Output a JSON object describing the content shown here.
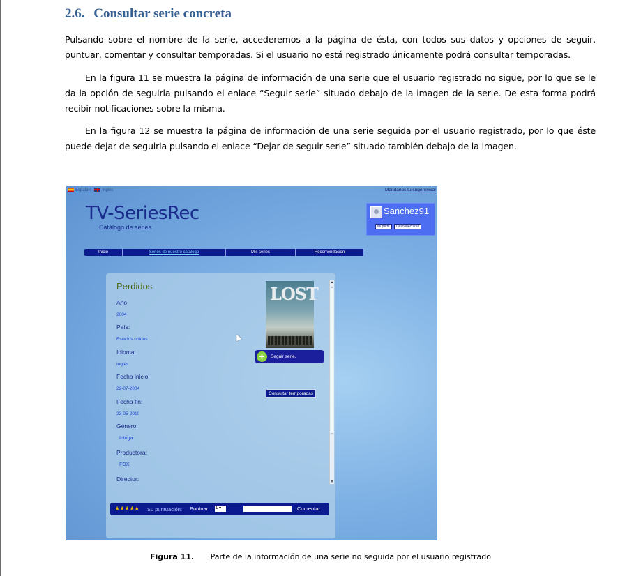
{
  "section": {
    "number": "2.6.",
    "title": "Consultar serie concreta"
  },
  "paragraphs": [
    "Pulsando sobre el nombre de la serie, accederemos a la página de ésta, con todos sus datos y opciones de seguir, puntuar, comentar y consultar temporadas. Si el usuario no está registrado únicamente podrá consultar temporadas.",
    "En la figura 11 se muestra la página de información de una serie que el usuario registrado no sigue, por lo que se le da la opción de seguirla pulsando el enlace “Seguir serie” situado debajo de la imagen de la serie. De esta forma podrá recibir notificaciones sobre la misma.",
    "En la figura 12 se muestra la página de información de una serie seguida por el usuario registrado, por lo que éste puede dejar de seguirla pulsando el enlace “Dejar de seguir serie” situado también debajo de la imagen."
  ],
  "screenshot": {
    "languages": [
      "Español",
      "Inglés"
    ],
    "suggestion_link": "Mándanos tu sugerencia!",
    "brand": "TV-SeriesRec",
    "tagline": "Catálogo de series",
    "user": {
      "name": "Sanchez91",
      "profile_link": "Mi perfil",
      "logout_link": "Desconectarse"
    },
    "nav": [
      "Inicio",
      "Series de nuestro catálogo",
      "Mis series",
      "Recomendacion"
    ],
    "series": {
      "title": "Perdidos",
      "poster_text": "LOST",
      "fields": [
        {
          "label": "Año",
          "value": "2004"
        },
        {
          "label": "País:",
          "value": "Estados unidos"
        },
        {
          "label": "Idioma:",
          "value": "Inglés"
        },
        {
          "label": "Fecha inicio:",
          "value": "22-07-2004"
        },
        {
          "label": "Fecha fin:",
          "value": "23-05-2010"
        },
        {
          "label": "Género:",
          "value": "Intriga"
        },
        {
          "label": "Productora:",
          "value": "FOX"
        },
        {
          "label": "Director:",
          "value": ""
        }
      ]
    },
    "follow_button": "Seguir serie.",
    "seasons_button": "Consultar temporadas",
    "rating": {
      "stars": "★★★★★",
      "score_label": "Su puntuación:",
      "rate_label": "Puntuar",
      "selected_value": "1",
      "comment_button": "Comentar"
    }
  },
  "caption": {
    "label": "Figura 11.",
    "text": "Parte de la información de una serie no seguida por el usuario registrado"
  },
  "colors": {
    "heading": "#365f91",
    "nav_bar": "#0b1a8e",
    "user_box": "#4d6ef0"
  }
}
